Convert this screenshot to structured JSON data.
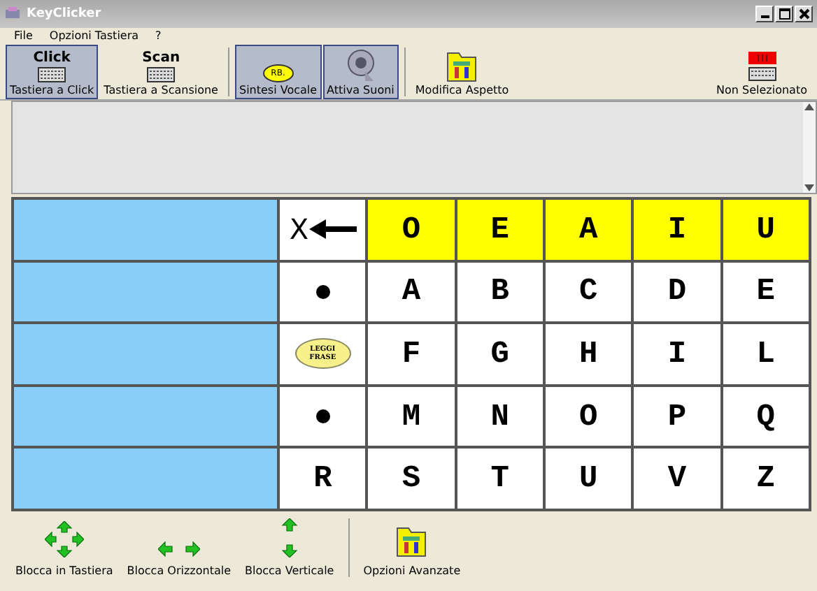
{
  "window": {
    "title": "KeyClicker"
  },
  "menu": [
    "File",
    "Opzioni Tastiera",
    "?"
  ],
  "toolbar": [
    {
      "kind": "click",
      "caption": "Click",
      "label": "Tastiera a Click",
      "selected": true
    },
    {
      "kind": "scan",
      "caption": "Scan",
      "label": "Tastiera a Scansione",
      "selected": false
    },
    {
      "kind": "speech",
      "caption": "RB.",
      "label": "Sintesi Vocale",
      "selected": true
    },
    {
      "kind": "speaker",
      "label": "Attiva Suoni",
      "selected": true
    },
    {
      "kind": "folder",
      "label": "Modifica Aspetto",
      "selected": false
    }
  ],
  "status": {
    "label": "Non Selezionato"
  },
  "grid": [
    {
      "highlighted": true,
      "cells": [
        {
          "kind": "backspace",
          "text": "X"
        },
        {
          "kind": "letter",
          "text": "O"
        },
        {
          "kind": "letter",
          "text": "E"
        },
        {
          "kind": "letter",
          "text": "A"
        },
        {
          "kind": "letter",
          "text": "I"
        },
        {
          "kind": "letter",
          "text": "U"
        }
      ]
    },
    {
      "highlighted": false,
      "cells": [
        {
          "kind": "dot"
        },
        {
          "kind": "letter",
          "text": "A"
        },
        {
          "kind": "letter",
          "text": "B"
        },
        {
          "kind": "letter",
          "text": "C"
        },
        {
          "kind": "letter",
          "text": "D"
        },
        {
          "kind": "letter",
          "text": "E"
        }
      ]
    },
    {
      "highlighted": false,
      "cells": [
        {
          "kind": "speech",
          "text": "LEGGI FRASE"
        },
        {
          "kind": "letter",
          "text": "F"
        },
        {
          "kind": "letter",
          "text": "G"
        },
        {
          "kind": "letter",
          "text": "H"
        },
        {
          "kind": "letter",
          "text": "I"
        },
        {
          "kind": "letter",
          "text": "L"
        }
      ]
    },
    {
      "highlighted": false,
      "cells": [
        {
          "kind": "dot"
        },
        {
          "kind": "letter",
          "text": "M"
        },
        {
          "kind": "letter",
          "text": "N"
        },
        {
          "kind": "letter",
          "text": "O"
        },
        {
          "kind": "letter",
          "text": "P"
        },
        {
          "kind": "letter",
          "text": "Q"
        }
      ]
    },
    {
      "highlighted": false,
      "cells": [
        {
          "kind": "letter",
          "text": "R"
        },
        {
          "kind": "letter",
          "text": "S"
        },
        {
          "kind": "letter",
          "text": "T"
        },
        {
          "kind": "letter",
          "text": "U"
        },
        {
          "kind": "letter",
          "text": "V"
        },
        {
          "kind": "letter",
          "text": "Z"
        }
      ]
    }
  ],
  "bottom_toolbar": [
    {
      "kind": "all",
      "label": "Blocca in Tastiera"
    },
    {
      "kind": "horizontal",
      "label": "Blocca Orizzontale"
    },
    {
      "kind": "vertical",
      "label": "Blocca Verticale"
    },
    {
      "kind": "folder",
      "label": "Opzioni Avanzate"
    }
  ]
}
